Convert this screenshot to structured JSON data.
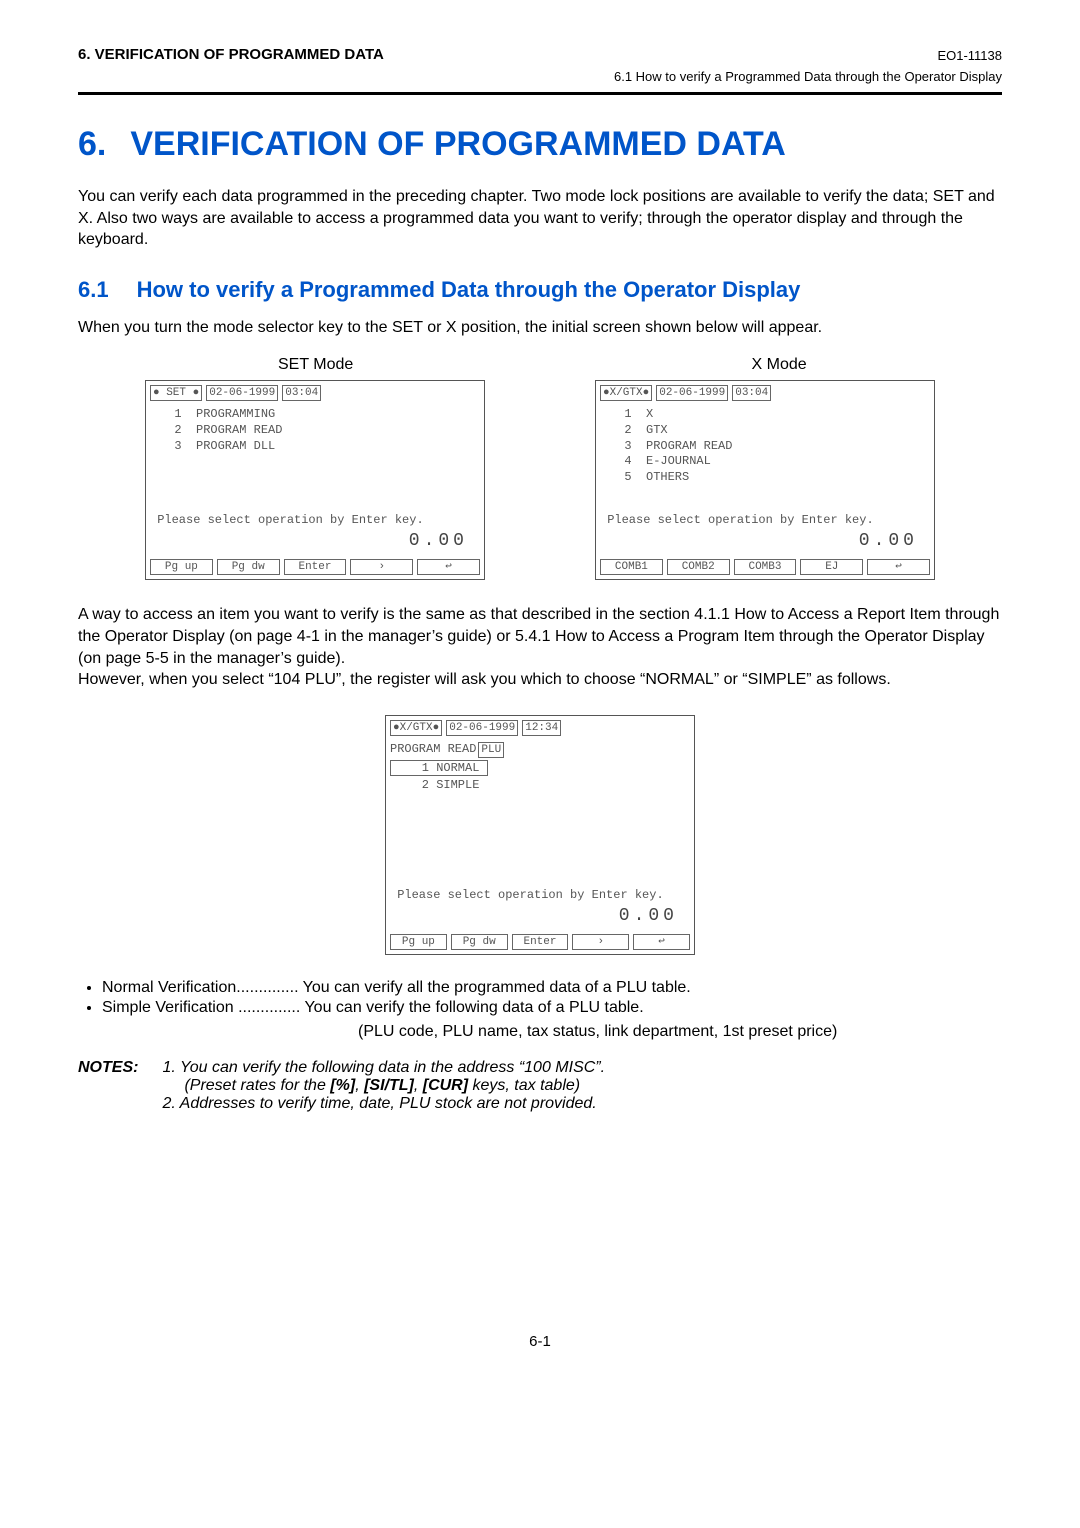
{
  "header": {
    "section_label": "6.  VERIFICATION OF PROGRAMMED DATA",
    "doc_code": "EO1-11138",
    "subheader": "6.1  How to verify a Programmed Data through the Operator Display"
  },
  "chapter": {
    "number": "6.",
    "title": "VERIFICATION OF PROGRAMMED DATA"
  },
  "intro": "You can verify each data programmed in the preceding chapter. Two mode lock positions are available to verify the data; SET and X. Also two ways are available to access a programmed data you want to verify; through the operator display and through the keyboard.",
  "section": {
    "number": "6.1",
    "title": "How to verify a Programmed Data through the Operator Display"
  },
  "section_intro": "When you turn the mode selector key to the SET or X position, the initial screen shown below will appear.",
  "mode_labels": {
    "left": "SET Mode",
    "right": "X Mode"
  },
  "panel_set": {
    "mode": "● SET ●",
    "date": "02-06-1999",
    "time": "03:04",
    "menu": "  1  PROGRAMMING\n  2  PROGRAM READ\n  3  PROGRAM DLL",
    "msg": " Please select operation by Enter key.",
    "amount": "0.00",
    "keys": [
      "Pg up",
      "Pg dw",
      "Enter",
      "›",
      "↩"
    ]
  },
  "panel_x": {
    "mode": "●X/GTX●",
    "date": "02-06-1999",
    "time": "03:04",
    "menu": "  1  X\n  2  GTX\n  3  PROGRAM READ\n  4  E-JOURNAL\n  5  OTHERS",
    "msg": " Please select operation by Enter key.",
    "amount": "0.00",
    "keys": [
      "COMB1",
      "COMB2",
      "COMB3",
      "EJ",
      "↩"
    ]
  },
  "mid_text_1": "A way to access an item you want to verify is the same as that described in the section 4.1.1 How to Access a Report Item through the Operator Display (on page 4-1 in the manager’s guide) or 5.4.1 How to Access a Program Item through the Operator Display (on page 5-5 in the manager’s guide).",
  "mid_text_2": "However, when you select “104 PLU”, the register will ask you which to choose “NORMAL” or “SIMPLE” as follows.",
  "panel_plu": {
    "mode": "●X/GTX●",
    "date": "02-06-1999",
    "time": "12:34",
    "subtitle_left": "PROGRAM READ",
    "subtitle_box": "PLU",
    "menu": "    1 NORMAL\n    2 SIMPLE",
    "msg": " Please select operation by Enter key.",
    "amount": "0.00",
    "keys": [
      "Pg up",
      "Pg dw",
      "Enter",
      "›",
      "↩"
    ]
  },
  "bullets": {
    "normal_label": "Normal Verification",
    "normal_dots": "..............",
    "normal_text": "You can verify all the programmed data of a PLU table.",
    "simple_label": "Simple Verification",
    "simple_dots": "..............",
    "simple_text": "You can verify the following data of a PLU table.",
    "simple_sub": "(PLU code, PLU name, tax status, link department, 1st preset price)"
  },
  "notes": {
    "label": "NOTES:",
    "line1": "1.  You can verify the following data in the address “100 MISC”.",
    "line2": "(Preset rates for the [%], [SI/TL], [CUR] keys, tax table)",
    "line3": "2.  Addresses to verify time, date, PLU stock are not provided."
  },
  "page_number": "6-1"
}
